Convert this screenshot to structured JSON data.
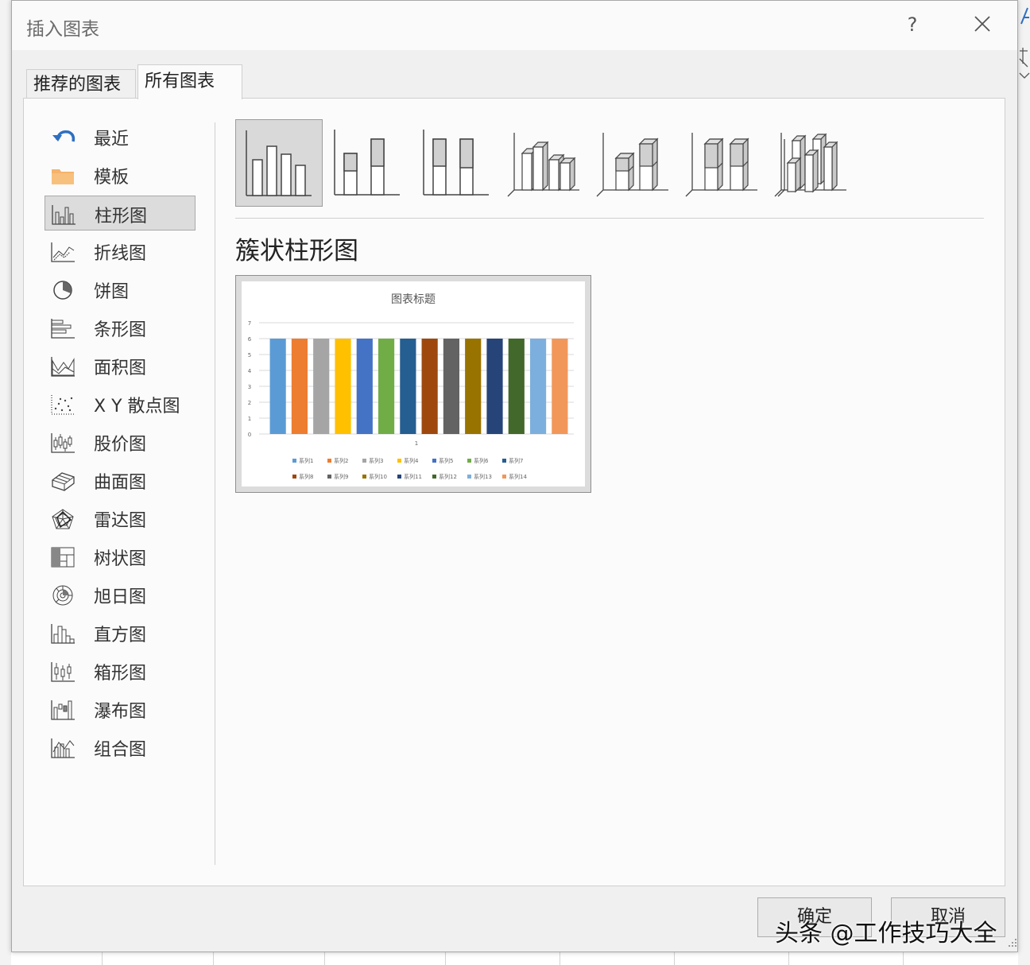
{
  "window": {
    "title": "插入图表",
    "help_label": "?"
  },
  "tabs": [
    {
      "label": "推荐的图表",
      "selected": false
    },
    {
      "label": "所有图表",
      "selected": true
    }
  ],
  "categories": [
    {
      "label": "最近",
      "icon": "recent-icon"
    },
    {
      "label": "模板",
      "icon": "folder-icon"
    },
    {
      "label": "柱形图",
      "icon": "column-chart-icon",
      "selected": true
    },
    {
      "label": "折线图",
      "icon": "line-chart-icon"
    },
    {
      "label": "饼图",
      "icon": "pie-chart-icon"
    },
    {
      "label": "条形图",
      "icon": "bar-chart-icon"
    },
    {
      "label": "面积图",
      "icon": "area-chart-icon"
    },
    {
      "label": "X Y 散点图",
      "icon": "scatter-chart-icon"
    },
    {
      "label": "股价图",
      "icon": "stock-chart-icon"
    },
    {
      "label": "曲面图",
      "icon": "surface-chart-icon"
    },
    {
      "label": "雷达图",
      "icon": "radar-chart-icon"
    },
    {
      "label": "树状图",
      "icon": "treemap-chart-icon"
    },
    {
      "label": "旭日图",
      "icon": "sunburst-chart-icon"
    },
    {
      "label": "直方图",
      "icon": "histogram-chart-icon"
    },
    {
      "label": "箱形图",
      "icon": "box-whisker-chart-icon"
    },
    {
      "label": "瀑布图",
      "icon": "waterfall-chart-icon"
    },
    {
      "label": "组合图",
      "icon": "combo-chart-icon"
    }
  ],
  "subtypes": [
    {
      "icon": "clustered-column-icon",
      "selected": true
    },
    {
      "icon": "stacked-column-icon"
    },
    {
      "icon": "100-stacked-column-icon"
    },
    {
      "icon": "3d-clustered-column-icon"
    },
    {
      "icon": "3d-stacked-column-icon"
    },
    {
      "icon": "3d-100-stacked-column-icon"
    },
    {
      "icon": "3d-column-icon"
    }
  ],
  "selected_type_name": "簇状柱形图",
  "chart_data": {
    "type": "bar",
    "title": "图表标题",
    "categories": [
      "1"
    ],
    "ylim": [
      0,
      7
    ],
    "yticks": [
      "0",
      "1",
      "2",
      "3",
      "4",
      "5",
      "6",
      "7"
    ],
    "grid": true,
    "legend_position": "bottom",
    "series": [
      {
        "name": "系列1",
        "values": [
          6
        ],
        "color": "#5b9bd5"
      },
      {
        "name": "系列2",
        "values": [
          6
        ],
        "color": "#ed7d31"
      },
      {
        "name": "系列3",
        "values": [
          6
        ],
        "color": "#a5a5a5"
      },
      {
        "name": "系列4",
        "values": [
          6
        ],
        "color": "#ffc000"
      },
      {
        "name": "系列5",
        "values": [
          6
        ],
        "color": "#4472c4"
      },
      {
        "name": "系列6",
        "values": [
          6
        ],
        "color": "#70ad47"
      },
      {
        "name": "系列7",
        "values": [
          6
        ],
        "color": "#255e91"
      },
      {
        "name": "系列8",
        "values": [
          6
        ],
        "color": "#9e480e"
      },
      {
        "name": "系列9",
        "values": [
          6
        ],
        "color": "#636363"
      },
      {
        "name": "系列10",
        "values": [
          6
        ],
        "color": "#997300"
      },
      {
        "name": "系列11",
        "values": [
          6
        ],
        "color": "#264478"
      },
      {
        "name": "系列12",
        "values": [
          6
        ],
        "color": "#43682b"
      },
      {
        "name": "系列13",
        "values": [
          6
        ],
        "color": "#7cafdd"
      },
      {
        "name": "系列14",
        "values": [
          6
        ],
        "color": "#f1975a"
      }
    ]
  },
  "buttons": {
    "ok": "确定",
    "cancel": "取消"
  },
  "watermark": "头条 @工作技巧大全"
}
